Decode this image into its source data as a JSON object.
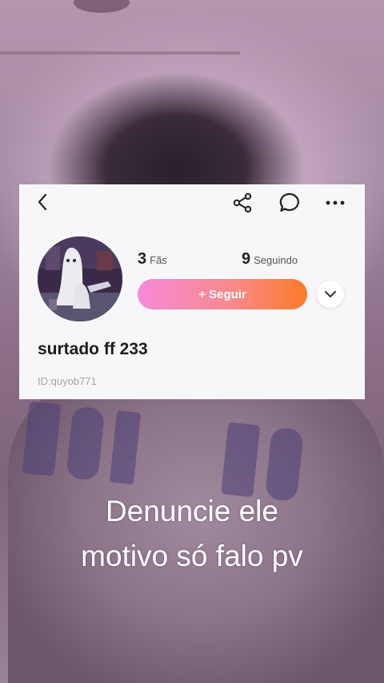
{
  "profile": {
    "fans_count": "3",
    "fans_label": "Fãs",
    "following_count": "9",
    "following_label": "Seguindo",
    "follow_label": "+ Seguir",
    "username": "surtado ff 233",
    "user_id": "ID:quyob771"
  },
  "icons": {
    "back": "back-icon",
    "share": "share-icon",
    "chat": "chat-icon",
    "more": "more-icon",
    "expand": "chevron-down-icon"
  },
  "colors": {
    "follow_gradient_start": "#f58ad9",
    "follow_gradient_end": "#fb7a2a",
    "card_background": "#f7f7f9"
  },
  "caption": {
    "line1": "Denuncie ele",
    "line2": "motivo só falo pv"
  }
}
